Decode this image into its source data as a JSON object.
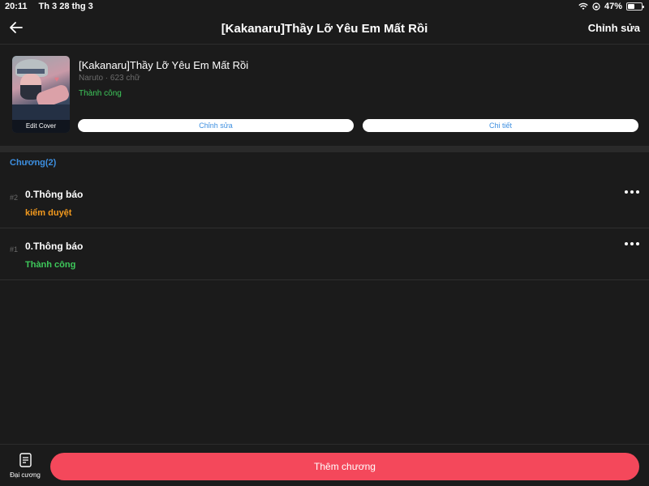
{
  "status_bar": {
    "time": "20:11",
    "date": "Th 3 28 thg 3",
    "battery": "47%"
  },
  "nav": {
    "title": "[Kakanaru]Thầy Lỡ Yêu Em Mất Rồi",
    "edit_label": "Chỉnh sửa"
  },
  "story": {
    "cover_caption": "Edit Cover",
    "title": "[Kakanaru]Thầy Lỡ Yêu Em Mất Rồi",
    "meta": "Naruto · 623 chữ",
    "status": "Thành công",
    "edit_button": "Chỉnh sửa",
    "detail_button": "Chi tiết"
  },
  "chapters_label": "Chương(2)",
  "chapters": [
    {
      "num": "#2",
      "title": "0.Thông báo",
      "status": "kiểm duyệt",
      "status_color": "#f39a1e"
    },
    {
      "num": "#1",
      "title": "0.Thông báo",
      "status": "Thành công",
      "status_color": "#3ec95b"
    }
  ],
  "bottom": {
    "outline_label": "Đại cương",
    "add_chapter_label": "Thêm chương"
  },
  "colors": {
    "accent_blue": "#3d8fe0",
    "accent_red": "#f4485b",
    "success_green": "#3ec95b",
    "pending_orange": "#f39a1e"
  }
}
